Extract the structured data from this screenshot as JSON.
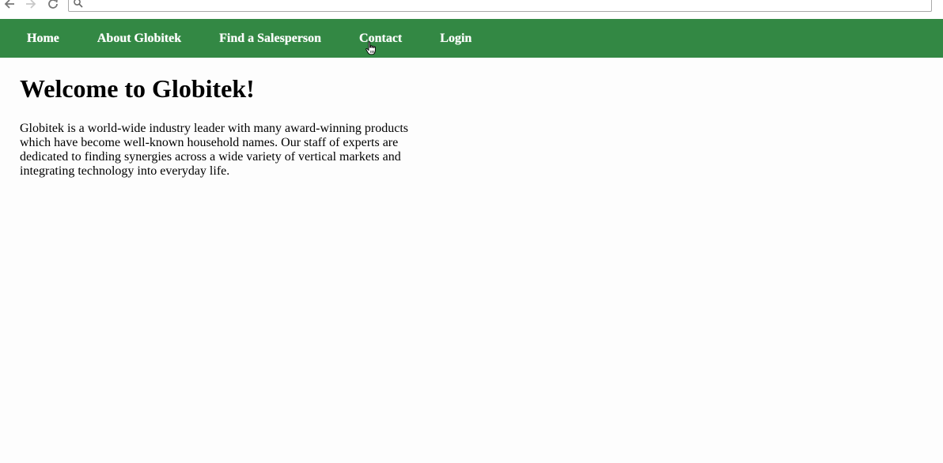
{
  "browser": {
    "back_icon": "arrow-left-icon",
    "forward_icon": "arrow-right-icon",
    "reload_icon": "reload-icon",
    "address_value": "",
    "search_icon": "magnifier-icon"
  },
  "nav": {
    "background_color": "#338844",
    "items": [
      {
        "label": "Home"
      },
      {
        "label": "About Globitek"
      },
      {
        "label": "Find a Salesperson"
      },
      {
        "label": "Contact"
      },
      {
        "label": "Login"
      }
    ]
  },
  "main": {
    "title": "Welcome to Globitek!",
    "intro": "Globitek is a world-wide industry leader with many award-winning products which have become well-known household names. Our staff of experts are dedicated to finding synergies across a wide variety of vertical markets and integrating technology into everyday life."
  }
}
